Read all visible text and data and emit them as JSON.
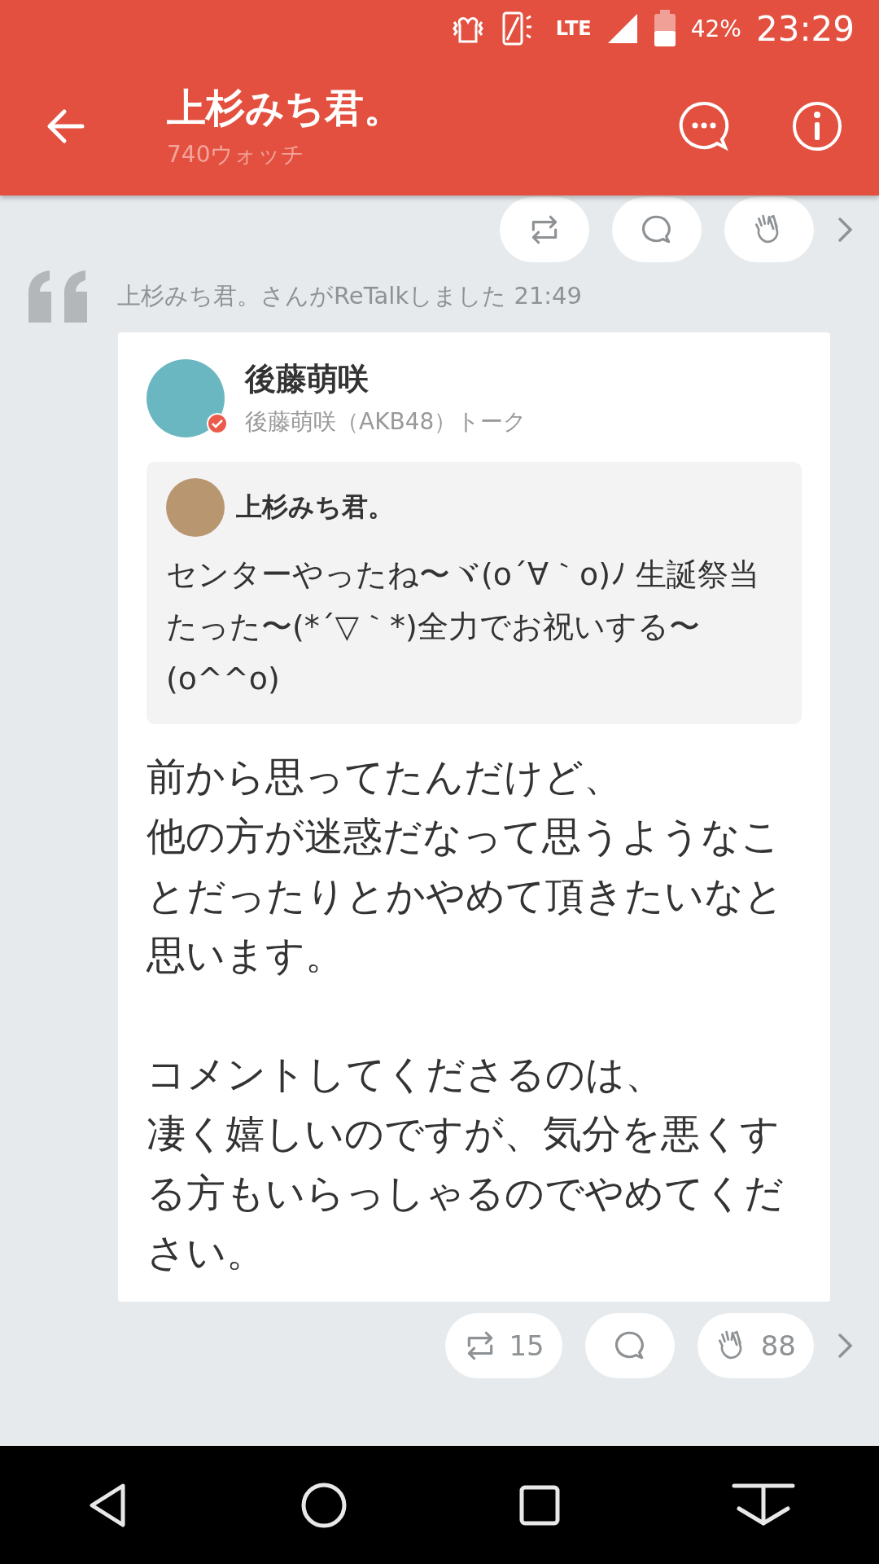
{
  "status_bar": {
    "network_label": "LTE",
    "battery": "42%",
    "time": "23:29"
  },
  "header": {
    "title": "上杉みち君。",
    "subtitle": "740ウォッチ"
  },
  "previous_post_actions": [
    {
      "kind": "retalk"
    },
    {
      "kind": "comment"
    },
    {
      "kind": "clap"
    }
  ],
  "retalk_notice": "上杉みち君。さんがReTalkしました 21:49",
  "post": {
    "author": "後藤萌咲",
    "talk": "後藤萌咲（AKB48）トーク",
    "verified": true,
    "quoted": {
      "author": "上杉みち君。",
      "text": "センターやったね〜ヾ(o´∀｀o)ﾉ 生誕祭当たった〜(*´▽｀*)全力でお祝いする〜(o^^o)"
    },
    "body_paragraphs": [
      [
        "前から思ってたんだけど、",
        "他の方が迷惑だなって思うようなことだったりとかやめて頂きたいなと思います。"
      ],
      [
        "コメントしてくださるのは、",
        "凄く嬉しいのですが、気分を悪くする方もいらっしゃるのでやめてください。"
      ]
    ]
  },
  "post_actions": [
    {
      "kind": "retalk",
      "count": "15"
    },
    {
      "kind": "comment"
    },
    {
      "kind": "clap",
      "count": "88"
    }
  ]
}
